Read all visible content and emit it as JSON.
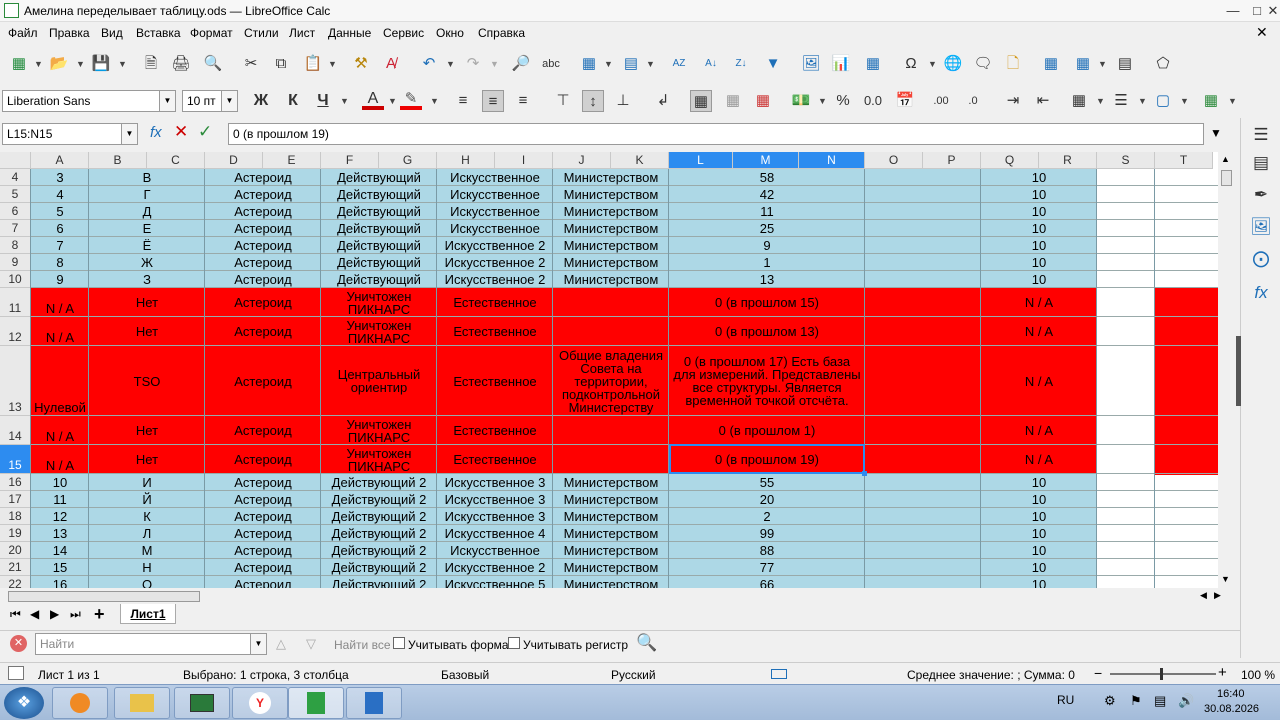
{
  "window": {
    "title": "Амелина переделывает таблицу.ods — LibreOffice Calc"
  },
  "menu": [
    "Файл",
    "Правка",
    "Вид",
    "Вставка",
    "Формат",
    "Стили",
    "Лист",
    "Данные",
    "Сервис",
    "Окно",
    "Справка"
  ],
  "format": {
    "font_name": "Liberation Sans",
    "font_size": "10 пт",
    "bold": "Ж",
    "italic": "К",
    "underline": "Ч"
  },
  "formula": {
    "name_box": "L15:N15",
    "content": "0 (в прошлом 19)"
  },
  "columns": [
    "A",
    "B",
    "C",
    "D",
    "E",
    "F",
    "G",
    "H",
    "I",
    "J",
    "K",
    "L",
    "M",
    "N",
    "O",
    "P",
    "Q",
    "R",
    "S",
    "T"
  ],
  "rows": [
    {
      "n": "4",
      "c": [
        "3",
        "В",
        "Астероид",
        "Действующий",
        "Искусственное",
        "Министерством",
        "58",
        "10"
      ]
    },
    {
      "n": "5",
      "c": [
        "4",
        "Г",
        "Астероид",
        "Действующий",
        "Искусственное",
        "Министерством",
        "42",
        "10"
      ]
    },
    {
      "n": "6",
      "c": [
        "5",
        "Д",
        "Астероид",
        "Действующий",
        "Искусственное",
        "Министерством",
        "11",
        "10"
      ]
    },
    {
      "n": "7",
      "c": [
        "6",
        "Е",
        "Астероид",
        "Действующий",
        "Искусственное",
        "Министерством",
        "25",
        "10"
      ]
    },
    {
      "n": "8",
      "c": [
        "7",
        "Ё",
        "Астероид",
        "Действующий",
        "Искусственное 2",
        "Министерством",
        "9",
        "10"
      ]
    },
    {
      "n": "9",
      "c": [
        "8",
        "Ж",
        "Астероид",
        "Действующий",
        "Искусственное 2",
        "Министерством",
        "1",
        "10"
      ]
    },
    {
      "n": "10",
      "c": [
        "9",
        "З",
        "Астероид",
        "Действующий",
        "Искусственное 2",
        "Министерством",
        "13",
        "10"
      ]
    },
    {
      "n": "11",
      "c": [
        "N / A",
        "Нет",
        "Астероид",
        "Уничтожен ПИКНАРС",
        "Естественное",
        "",
        "0 (в прошлом 15)",
        "N / A"
      ]
    },
    {
      "n": "12",
      "c": [
        "N / A",
        "Нет",
        "Астероид",
        "Уничтожен ПИКНАРС",
        "Естественное",
        "",
        "0 (в прошлом 13)",
        "N / A"
      ]
    },
    {
      "n": "13",
      "c": [
        "Нулевой",
        "TSO",
        "Астероид",
        "Центральный ориентир",
        "Естественное",
        "Общие владения Совета на территории, подконтрольной Министерству",
        "0 (в прошлом 17) Есть база для измерений. Представлены все структуры. Является временной точкой отсчёта.",
        "N / A"
      ]
    },
    {
      "n": "14",
      "c": [
        "N / A",
        "Нет",
        "Астероид",
        "Уничтожен ПИКНАРС",
        "Естественное",
        "",
        "0 (в прошлом 1)",
        "N / A"
      ]
    },
    {
      "n": "15",
      "c": [
        "N / A",
        "Нет",
        "Астероид",
        "Уничтожен ПИКНАРС",
        "Естественное",
        "",
        "0 (в прошлом 19)",
        "N / A"
      ]
    },
    {
      "n": "16",
      "c": [
        "10",
        "И",
        "Астероид",
        "Действующий 2",
        "Искусственное 3",
        "Министерством",
        "55",
        "10"
      ]
    },
    {
      "n": "17",
      "c": [
        "11",
        "Й",
        "Астероид",
        "Действующий 2",
        "Искусственное 3",
        "Министерством",
        "20",
        "10"
      ]
    },
    {
      "n": "18",
      "c": [
        "12",
        "К",
        "Астероид",
        "Действующий 2",
        "Искусственное 3",
        "Министерством",
        "2",
        "10"
      ]
    },
    {
      "n": "19",
      "c": [
        "13",
        "Л",
        "Астероид",
        "Действующий 2",
        "Искусственное 4",
        "Министерством",
        "99",
        "10"
      ]
    },
    {
      "n": "20",
      "c": [
        "14",
        "М",
        "Астероид",
        "Действующий 2",
        "Искусственное",
        "Министерством",
        "88",
        "10"
      ]
    },
    {
      "n": "21",
      "c": [
        "15",
        "Н",
        "Астероид",
        "Действующий 2",
        "Искусственное 2",
        "Министерством",
        "77",
        "10"
      ]
    },
    {
      "n": "22",
      "c": [
        "16",
        "О",
        "Астероид",
        "Действующий 2",
        "Искусственное 5",
        "Министерством",
        "66",
        "10"
      ]
    }
  ],
  "sheet_tab": "Лист1",
  "find": {
    "placeholder": "Найти",
    "find_all": "Найти все",
    "match_format": "Учитывать формат",
    "match_case": "Учитывать регистр"
  },
  "status": {
    "sheet": "Лист 1 из 1",
    "selection": "Выбрано: 1 строка, 3 столбца",
    "style": "Базовый",
    "language": "Русский",
    "sum": "Среднее значение: ; Сумма: 0",
    "zoom": "100 %"
  },
  "taskbar": {
    "lang": "RU",
    "time": "16:40",
    "date": "30.08.2026"
  },
  "colors": {
    "row_blue": "#add8e6",
    "row_red": "#ff0000",
    "selection": "#2d8cf0"
  }
}
